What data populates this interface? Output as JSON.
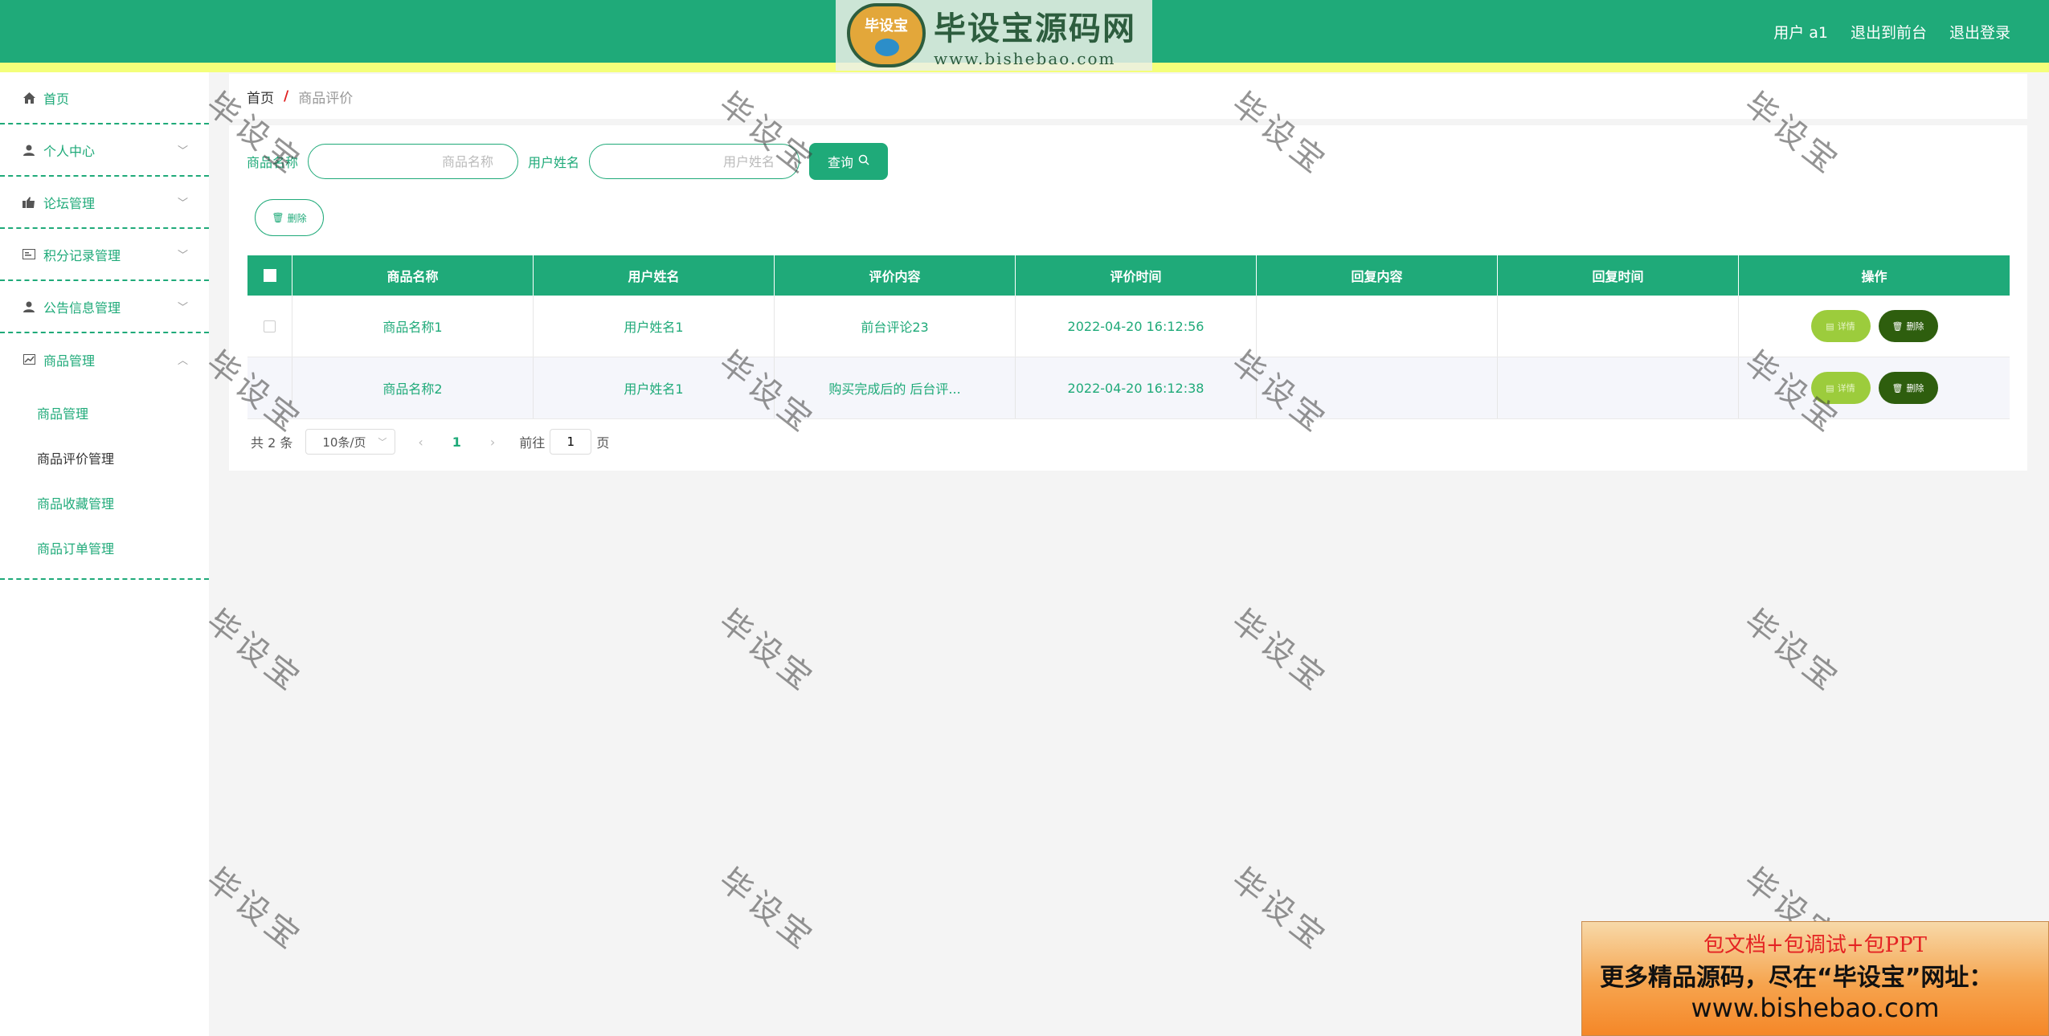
{
  "header": {
    "logo_badge": "毕设宝",
    "logo_title": "毕设宝源码网",
    "logo_url": "www.bishebao.com",
    "user_label": "用户 a1",
    "back_front": "退出到前台",
    "logout": "退出登录"
  },
  "sidebar": {
    "items": [
      {
        "label": "首页",
        "icon": "home-icon"
      },
      {
        "label": "个人中心",
        "icon": "user-icon"
      },
      {
        "label": "论坛管理",
        "icon": "forum-icon"
      },
      {
        "label": "积分记录管理",
        "icon": "card-icon"
      },
      {
        "label": "公告信息管理",
        "icon": "person-icon"
      },
      {
        "label": "商品管理",
        "icon": "chart-icon"
      }
    ],
    "submenu": [
      {
        "label": "商品管理"
      },
      {
        "label": "商品评价管理"
      },
      {
        "label": "商品收藏管理"
      },
      {
        "label": "商品订单管理"
      }
    ]
  },
  "breadcrumb": {
    "home": "首页",
    "separator": "/",
    "current": "商品评价"
  },
  "search": {
    "product_label": "商品名称",
    "product_placeholder": "商品名称",
    "user_label": "用户姓名",
    "user_placeholder": "用户姓名",
    "query_button": "查询"
  },
  "toolbar": {
    "delete_label": "删除"
  },
  "table": {
    "headers": [
      "商品名称",
      "用户姓名",
      "评价内容",
      "评价时间",
      "回复内容",
      "回复时间",
      "操作"
    ],
    "rows": [
      [
        "商品名称1",
        "用户姓名1",
        "前台评论23",
        "2022-04-20 16:12:56",
        "",
        ""
      ],
      [
        "商品名称2",
        "用户姓名1",
        "购买完成后的 后台评...",
        "2022-04-20 16:12:38",
        "",
        ""
      ]
    ],
    "detail_label": "详情",
    "delete_label": "删除"
  },
  "pagination": {
    "total": "共 2 条",
    "page_size": "10条/页",
    "current_page": "1",
    "goto_prefix": "前往",
    "goto_value": "1",
    "goto_suffix": "页"
  },
  "watermark": "毕设宝",
  "ad": {
    "line1": "包文档+包调试+包PPT",
    "line2": "更多精品源码，尽在“毕设宝”网址：",
    "line3": "www.bishebao.com"
  },
  "colors": {
    "primary": "#1faa79",
    "stripe": "#f4ff7a",
    "detail_button": "#9ccc3c",
    "delete_button": "#2e5e0e"
  }
}
